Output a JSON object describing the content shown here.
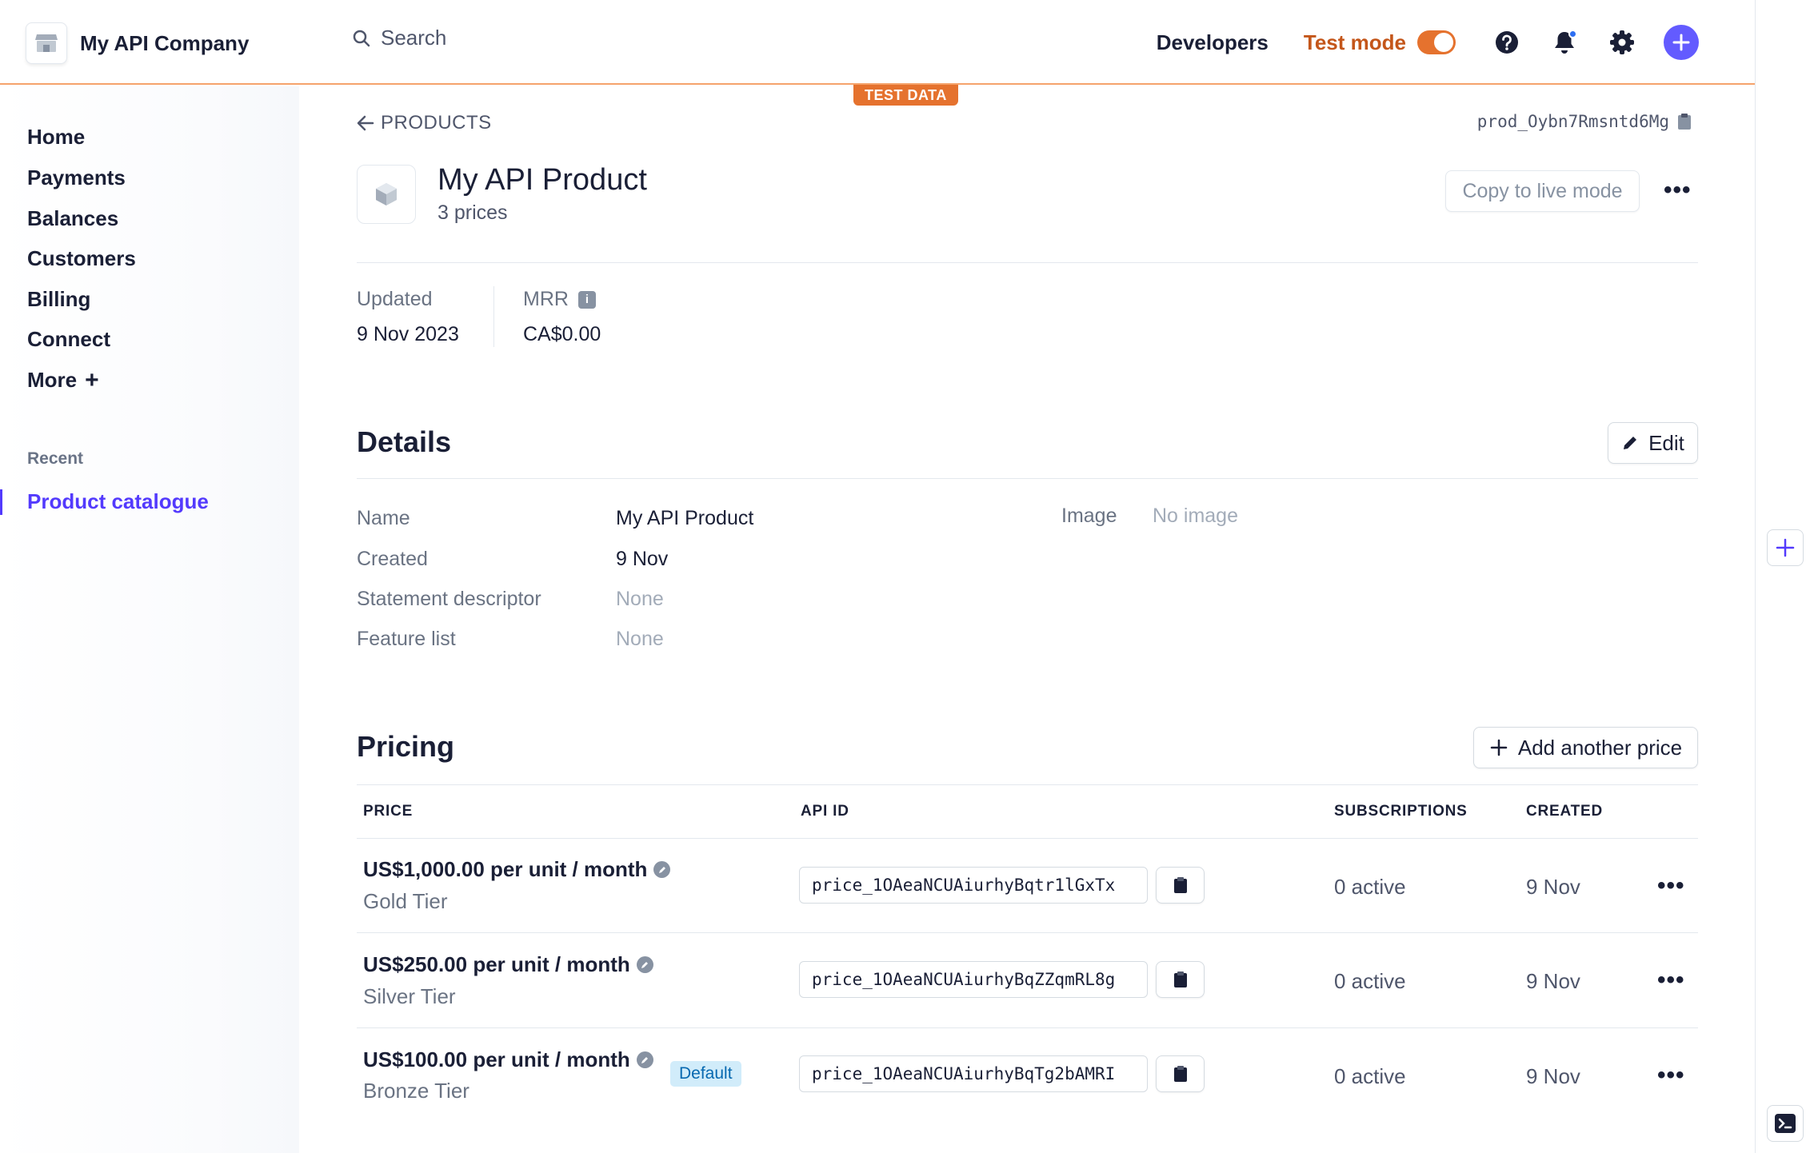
{
  "header": {
    "company_name": "My API Company",
    "search_placeholder": "Search",
    "developers_label": "Developers",
    "test_mode_label": "Test mode",
    "test_mode_on": true
  },
  "sidebar": {
    "items": [
      {
        "label": "Home"
      },
      {
        "label": "Payments"
      },
      {
        "label": "Balances"
      },
      {
        "label": "Customers"
      },
      {
        "label": "Billing"
      },
      {
        "label": "Connect"
      },
      {
        "label": "More"
      }
    ],
    "recent_label": "Recent",
    "recent_items": [
      {
        "label": "Product catalogue"
      }
    ]
  },
  "test_data_badge": "TEST DATA",
  "product": {
    "breadcrumb": "PRODUCTS",
    "id": "prod_Oybn7Rmsntd6Mg",
    "name": "My API Product",
    "price_count": "3 prices",
    "copy_live_label": "Copy to live mode",
    "stats": {
      "updated_label": "Updated",
      "updated_value": "9 Nov 2023",
      "mrr_label": "MRR",
      "mrr_value": "CA$0.00"
    }
  },
  "details": {
    "title": "Details",
    "edit_label": "Edit",
    "fields": [
      {
        "label": "Name",
        "value": "My API Product"
      },
      {
        "label": "Created",
        "value": "9 Nov"
      },
      {
        "label": "Statement descriptor",
        "value": "None"
      },
      {
        "label": "Feature list",
        "value": "None"
      }
    ],
    "image_label": "Image",
    "image_value": "No image"
  },
  "pricing": {
    "title": "Pricing",
    "add_price_label": "Add another price",
    "columns": {
      "price": "PRICE",
      "api_id": "API ID",
      "subscriptions": "SUBSCRIPTIONS",
      "created": "CREATED"
    },
    "rows": [
      {
        "price": "US$1,000.00 per unit / month",
        "tier": "Gold Tier",
        "api_id": "price_1OAeaNCUAiurhyBqtr1lGxTx",
        "subscriptions": "0 active",
        "created": "9 Nov"
      },
      {
        "price": "US$250.00 per unit / month",
        "tier": "Silver Tier",
        "api_id": "price_1OAeaNCUAiurhyBqZZqmRL8g",
        "subscriptions": "0 active",
        "created": "9 Nov"
      },
      {
        "price": "US$100.00 per unit / month",
        "tier": "Bronze Tier",
        "api_id": "price_1OAeaNCUAiurhyBqTg2bAMRI",
        "subscriptions": "0 active",
        "created": "9 Nov",
        "badge": "Default"
      }
    ]
  },
  "colors": {
    "accent": "#533afd",
    "test_mode": "#e5722e",
    "text": "#1a1f36",
    "muted": "#6a7383"
  }
}
